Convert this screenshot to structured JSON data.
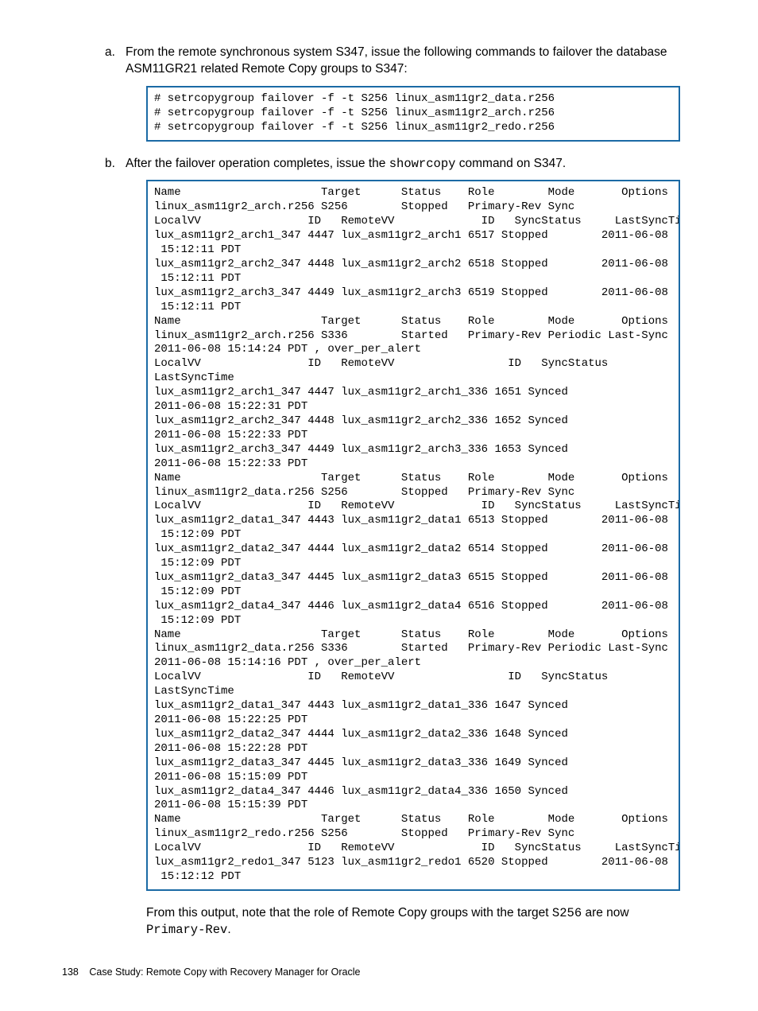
{
  "items": {
    "a": {
      "marker": "a.",
      "text_before": "From the remote synchronous system S347, issue the following commands to failover the database ASM11GR21 related Remote Copy groups to S347:"
    },
    "b": {
      "marker": "b.",
      "text_before": "After the failover operation completes, issue the ",
      "code_inline": "showrcopy",
      "text_after": " command on S347."
    }
  },
  "code1": "# setrcopygroup failover -f -t S256 linux_asm11gr2_data.r256\n# setrcopygroup failover -f -t S256 linux_asm11gr2_arch.r256\n# setrcopygroup failover -f -t S256 linux_asm11gr2_redo.r256",
  "code2": "Name                     Target      Status    Role        Mode       Options\nlinux_asm11gr2_arch.r256 S256        Stopped   Primary-Rev Sync\nLocalVV                ID   RemoteVV             ID   SyncStatus     LastSyncTime\nlux_asm11gr2_arch1_347 4447 lux_asm11gr2_arch1 6517 Stopped        2011-06-08\n 15:12:11 PDT\nlux_asm11gr2_arch2_347 4448 lux_asm11gr2_arch2 6518 Stopped        2011-06-08\n 15:12:11 PDT\nlux_asm11gr2_arch3_347 4449 lux_asm11gr2_arch3 6519 Stopped        2011-06-08\n 15:12:11 PDT\nName                     Target      Status    Role        Mode       Options\nlinux_asm11gr2_arch.r256 S336        Started   Primary-Rev Periodic Last-Sync\n2011-06-08 15:14:24 PDT , over_per_alert\nLocalVV                ID   RemoteVV                 ID   SyncStatus\nLastSyncTime\nlux_asm11gr2_arch1_347 4447 lux_asm11gr2_arch1_336 1651 Synced\n2011-06-08 15:22:31 PDT\nlux_asm11gr2_arch2_347 4448 lux_asm11gr2_arch2_336 1652 Synced\n2011-06-08 15:22:33 PDT\nlux_asm11gr2_arch3_347 4449 lux_asm11gr2_arch3_336 1653 Synced\n2011-06-08 15:22:33 PDT\nName                     Target      Status    Role        Mode       Options\nlinux_asm11gr2_data.r256 S256        Stopped   Primary-Rev Sync\nLocalVV                ID   RemoteVV             ID   SyncStatus     LastSyncTime\nlux_asm11gr2_data1_347 4443 lux_asm11gr2_data1 6513 Stopped        2011-06-08\n 15:12:09 PDT\nlux_asm11gr2_data2_347 4444 lux_asm11gr2_data2 6514 Stopped        2011-06-08\n 15:12:09 PDT\nlux_asm11gr2_data3_347 4445 lux_asm11gr2_data3 6515 Stopped        2011-06-08\n 15:12:09 PDT\nlux_asm11gr2_data4_347 4446 lux_asm11gr2_data4 6516 Stopped        2011-06-08\n 15:12:09 PDT\nName                     Target      Status    Role        Mode       Options\nlinux_asm11gr2_data.r256 S336        Started   Primary-Rev Periodic Last-Sync\n2011-06-08 15:14:16 PDT , over_per_alert\nLocalVV                ID   RemoteVV                 ID   SyncStatus\nLastSyncTime\nlux_asm11gr2_data1_347 4443 lux_asm11gr2_data1_336 1647 Synced\n2011-06-08 15:22:25 PDT\nlux_asm11gr2_data2_347 4444 lux_asm11gr2_data2_336 1648 Synced\n2011-06-08 15:22:28 PDT\nlux_asm11gr2_data3_347 4445 lux_asm11gr2_data3_336 1649 Synced\n2011-06-08 15:15:09 PDT\nlux_asm11gr2_data4_347 4446 lux_asm11gr2_data4_336 1650 Synced\n2011-06-08 15:15:39 PDT\nName                     Target      Status    Role        Mode       Options\nlinux_asm11gr2_redo.r256 S256        Stopped   Primary-Rev Sync\nLocalVV                ID   RemoteVV             ID   SyncStatus     LastSyncTime\nlux_asm11gr2_redo1_347 5123 lux_asm11gr2_redo1 6520 Stopped        2011-06-08\n 15:12:12 PDT",
  "after_output": {
    "text_before": "From this output, note that the role of Remote Copy groups with the target ",
    "code1": "S256",
    "text_mid": " are now ",
    "code2": "Primary-Rev",
    "text_after": "."
  },
  "footer": {
    "page": "138",
    "title": "Case Study: Remote Copy with Recovery Manager for Oracle"
  }
}
